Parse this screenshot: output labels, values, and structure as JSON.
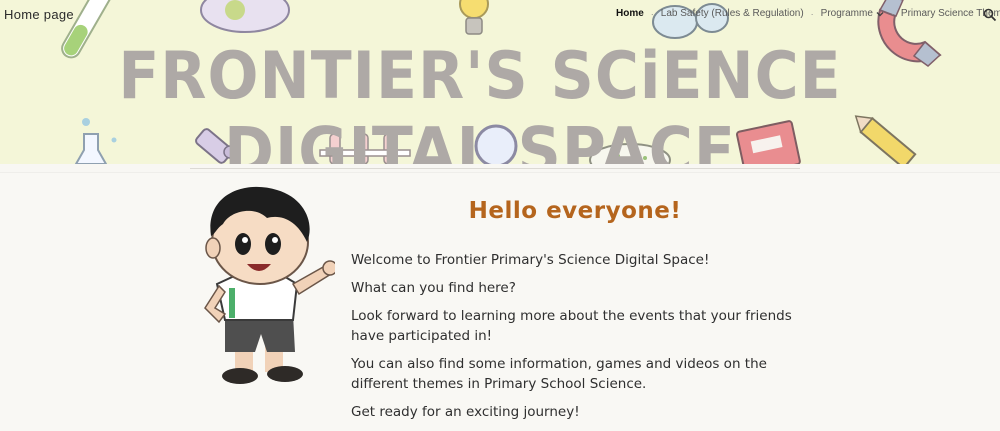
{
  "site": {
    "name": "Home page"
  },
  "nav": {
    "items": [
      {
        "label": "Home"
      },
      {
        "label": "Lab Safety (Rules & Regulation)"
      },
      {
        "label": "Programme"
      },
      {
        "label": "Primary Science Themes"
      }
    ],
    "separator": "·"
  },
  "banner": {
    "title": "FRONTIER'S SCiENCE DIGITAL SPACE"
  },
  "main": {
    "greeting": "Hello everyone!",
    "paragraphs": [
      "Welcome to Frontier Primary's Science Digital Space!",
      "What can you find here?",
      "Look forward to learning more about the events that your friends have participated in!",
      "You can also find some information, games and videos on the different themes in Primary School Science.",
      "Get ready for an exciting journey!"
    ]
  },
  "icons": {
    "search": "search-icon",
    "chevron": "chevron-down-icon",
    "mascot": "boy-mascot-illustration"
  },
  "colors": {
    "banner_bg": "#f4f6d8",
    "title": "#aea9a6",
    "greeting": "#b5651d",
    "body_text": "#2f2f2f"
  }
}
